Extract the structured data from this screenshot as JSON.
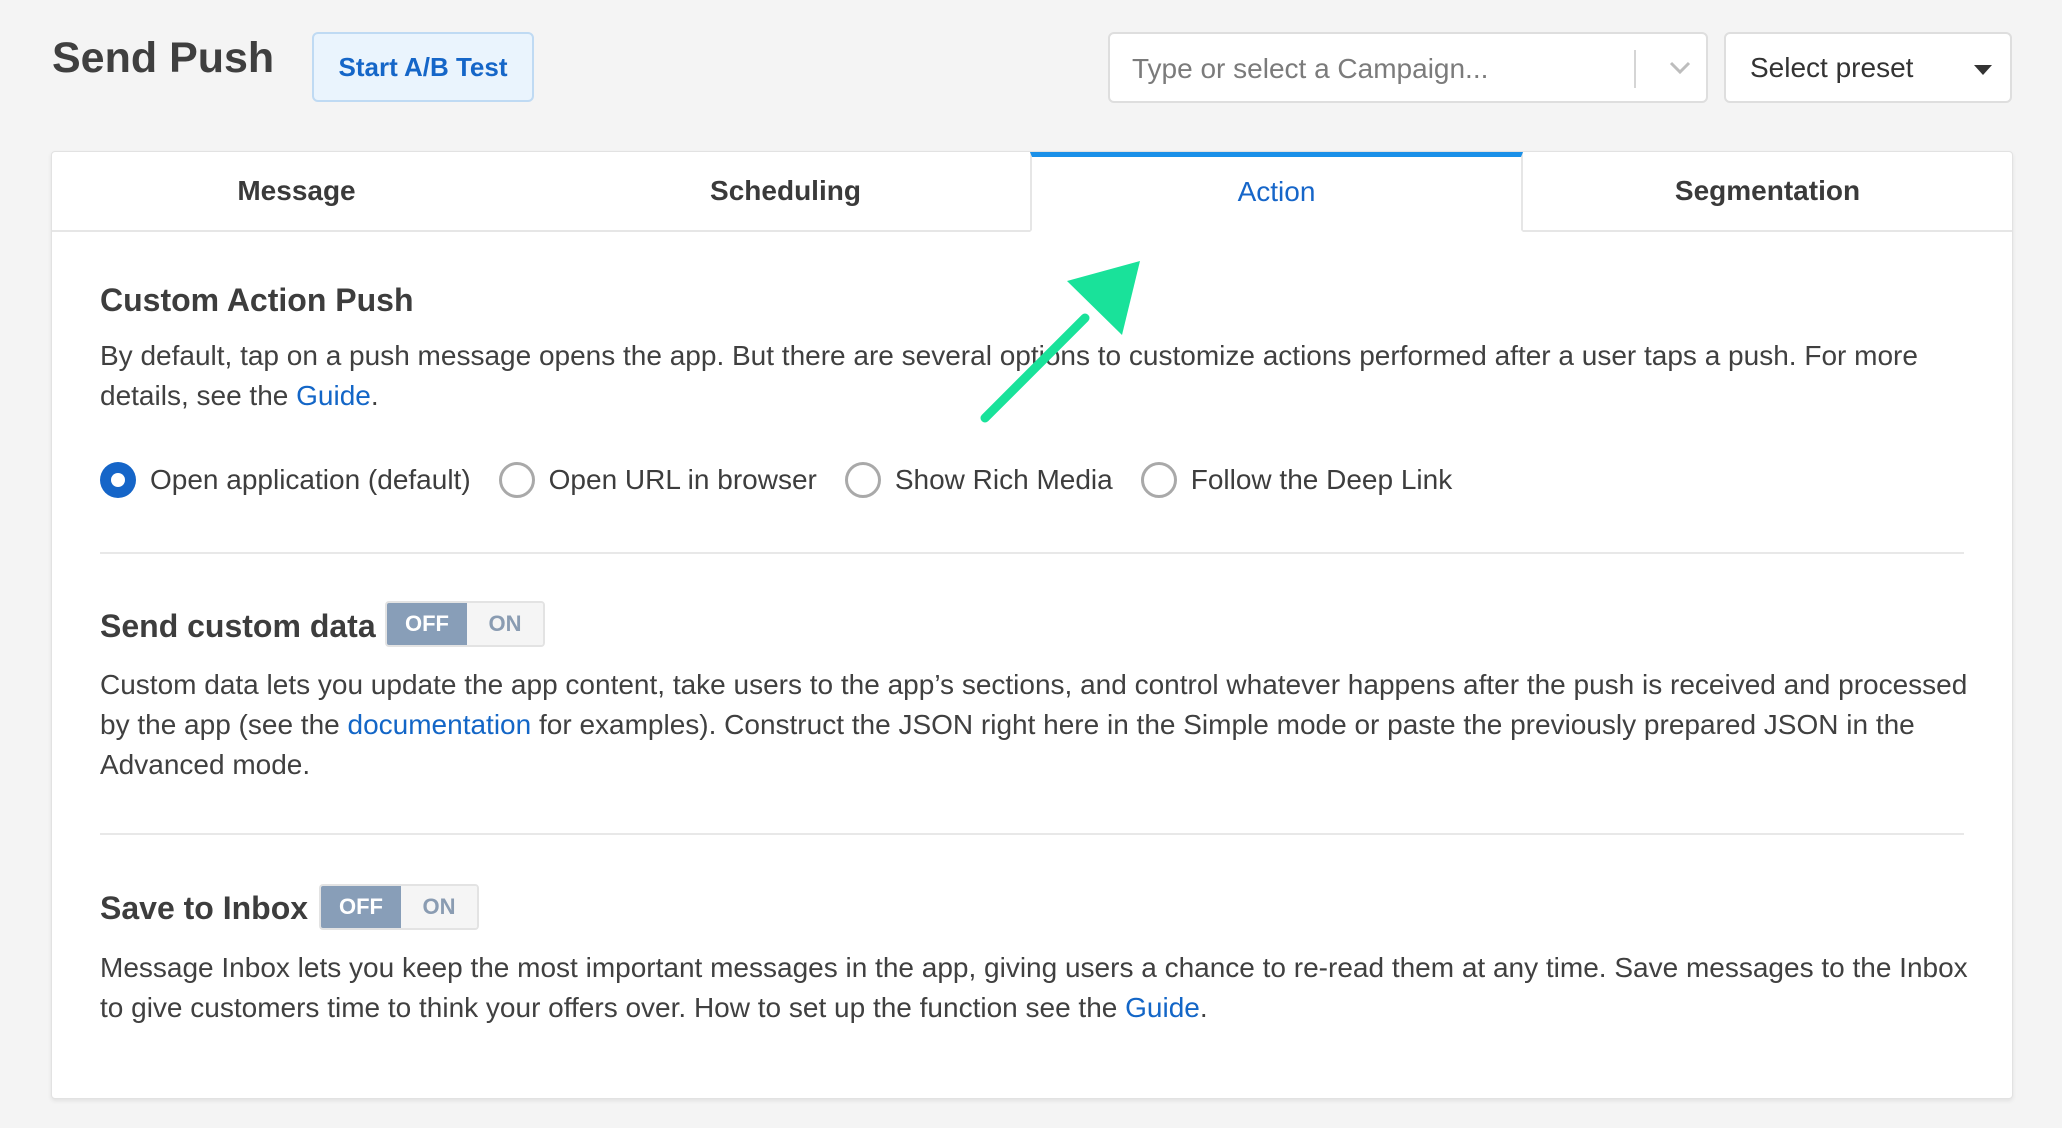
{
  "header": {
    "title": "Send Push",
    "ab_test_label": "Start A/B Test",
    "campaign_placeholder": "Type or select a Campaign...",
    "preset_label": "Select preset"
  },
  "tabs": [
    {
      "label": "Message",
      "active": false
    },
    {
      "label": "Scheduling",
      "active": false
    },
    {
      "label": "Action",
      "active": true
    },
    {
      "label": "Segmentation",
      "active": false
    }
  ],
  "custom_action": {
    "title": "Custom Action Push",
    "desc_line1": "By default, tap on a push message opens the app. But there are several options to customize actions performed after a user taps a push. For more",
    "desc_line2_prefix": "details, see the ",
    "desc_link": "Guide",
    "desc_line2_suffix": ".",
    "options": [
      {
        "label": "Open application (default)",
        "checked": true
      },
      {
        "label": "Open URL in browser",
        "checked": false
      },
      {
        "label": "Show Rich Media",
        "checked": false
      },
      {
        "label": "Follow the Deep Link",
        "checked": false
      }
    ]
  },
  "custom_data": {
    "title": "Send custom data",
    "toggle_off": "OFF",
    "toggle_on": "ON",
    "line1": "Custom data lets you update the app content, take users to the app’s sections, and control whatever happens after the push is received and processed",
    "line2_prefix": "by the app (see the ",
    "line2_link": "documentation",
    "line2_suffix": " for examples). Construct the JSON right here in the Simple mode or paste the previously prepared JSON in the",
    "line3": "Advanced mode."
  },
  "inbox": {
    "title": "Save to Inbox",
    "toggle_off": "OFF",
    "toggle_on": "ON",
    "line1": "Message Inbox lets you keep the most important messages in the app, giving users a chance to re-read them at any time. Save messages to the Inbox",
    "line2_prefix": "to give customers time to think your offers over. How to set up the function see the ",
    "line2_link": "Guide",
    "line2_suffix": "."
  },
  "colors": {
    "accent": "#1a90e8",
    "link": "#1366c7",
    "annotation_arrow": "#19e29a",
    "toggle_off_bg": "#889eb8"
  }
}
